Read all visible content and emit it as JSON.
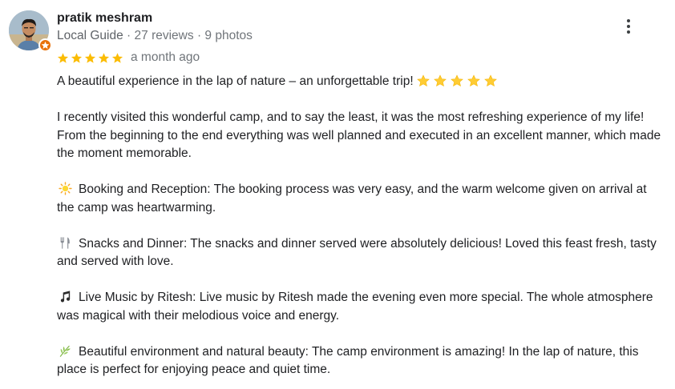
{
  "review": {
    "author_name": "pratik meshram",
    "local_guide_label": "Local Guide",
    "separator": "·",
    "reviews_count": "27 reviews",
    "photos_count": "9 photos",
    "rating": 5,
    "time_ago": "a month ago",
    "more_options_icon": "more-vert-icon",
    "badge_icon": "local-guide-star-badge",
    "headline": "A beautiful experience in the lap of nature – an unforgettable trip!",
    "headline_emoji": "star-emoji x5",
    "intro": "I recently visited this wonderful camp, and to say the least, it was the most refreshing experience of my life! From the beginning to the end everything was well planned and executed in an excellent manner, which made the moment memorable.",
    "sections": [
      {
        "icon": "sun-emoji",
        "text": "Booking and Reception: The booking process was very easy, and the warm welcome given on arrival at the camp was heartwarming."
      },
      {
        "icon": "fork-knife-emoji",
        "text": "Snacks and Dinner: The snacks and dinner served were absolutely delicious! Loved this feast fresh, tasty and served with love."
      },
      {
        "icon": "musical-notes-emoji",
        "text": "Live Music by Ritesh: Live music by Ritesh made the evening even more special. The whole atmosphere was magical with their melodious voice and energy."
      },
      {
        "icon": "herb-emoji",
        "text": "Beautiful environment and natural beauty: The camp environment is amazing! In the lap of nature, this place is perfect for enjoying peace and quiet time."
      }
    ]
  },
  "colors": {
    "star_rating": "#fbbc04",
    "emoji_star": "#ffcc33",
    "guide_badge": "#e8710a",
    "text_primary": "#202124",
    "text_secondary": "#70757a"
  }
}
